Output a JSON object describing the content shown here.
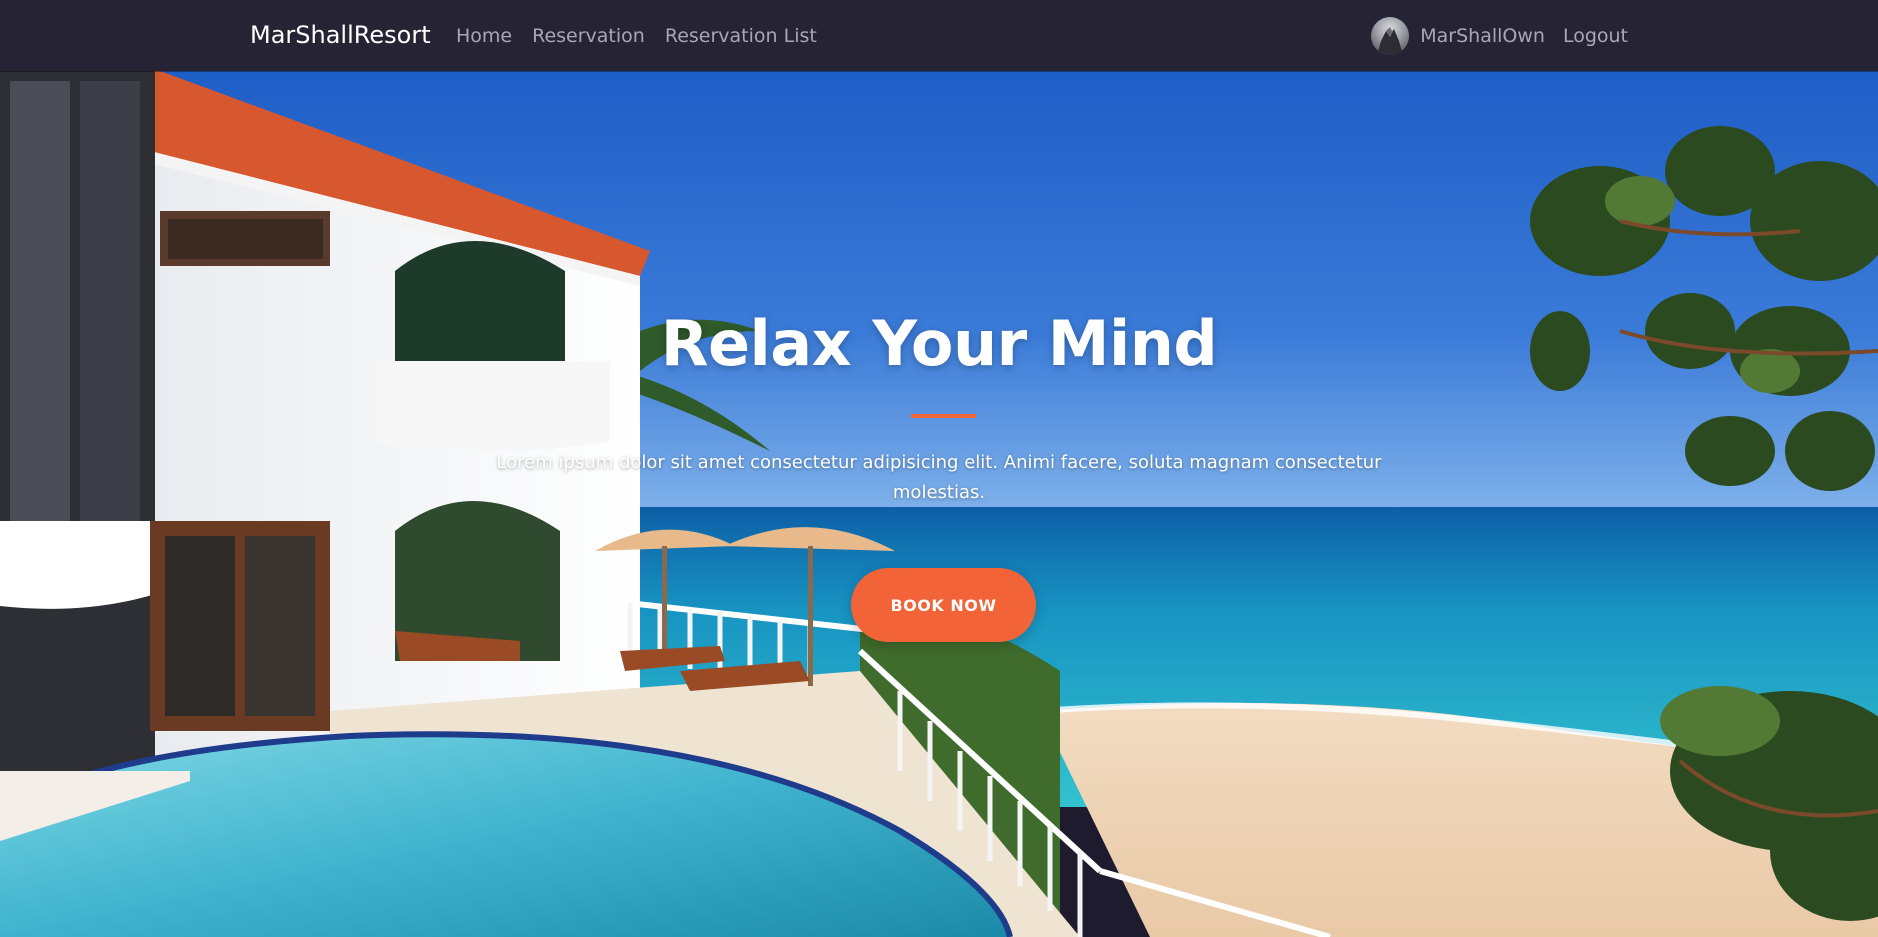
{
  "navbar": {
    "brand": "MarShallResort",
    "links": [
      {
        "label": "Home"
      },
      {
        "label": "Reservation"
      },
      {
        "label": "Reservation List"
      }
    ],
    "user_name": "MarShallOwn",
    "logout_label": "Logout"
  },
  "hero": {
    "title": "Relax Your Mind",
    "text_line1": "Lorem ipsum dolor sit amet consectetur adipisicing elit. Animi facere, soluta magnam consectetur",
    "text_line2": "molestias.",
    "button_label": "BOOK NOW"
  },
  "colors": {
    "navbar_bg": "#262335",
    "accent": "#f26438",
    "nav_link": "#a9a7b4",
    "sky": "#2f6fd0",
    "sea": "#1aa7c9"
  }
}
